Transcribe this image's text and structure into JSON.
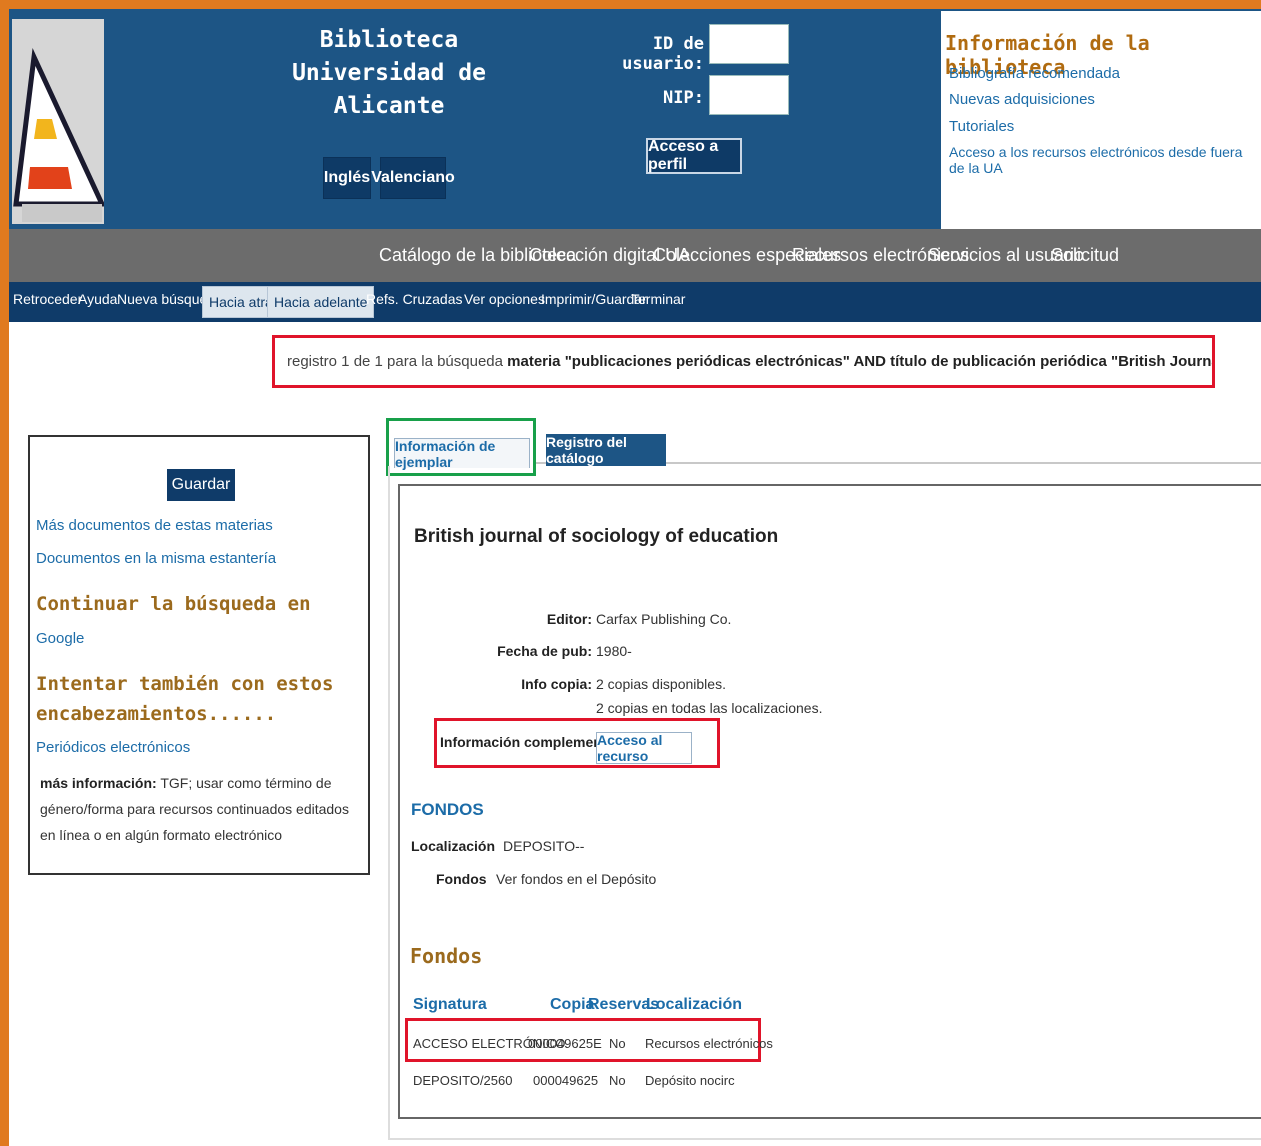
{
  "header": {
    "title_line1": "Biblioteca",
    "title_line2": "Universidad de Alicante",
    "lang_en": "Inglés",
    "lang_va": "Valenciano",
    "user_id_label": "ID de usuario:",
    "nip_label": "NIP:",
    "perfil_button": "Acceso a perfil",
    "info_title": "Información de la biblioteca",
    "info_links": [
      "Bibliografía recomendada",
      "Nuevas adquisiciones",
      "Tutoriales",
      "Acceso a los recursos electrónicos desde fuera de la UA"
    ]
  },
  "main_nav": [
    "Catálogo de la biblioteca",
    "Colección digital UA",
    "Colecciones especiales",
    "Recursos electrónicos",
    "Servicios al usuario",
    "Solicitud"
  ],
  "sub_nav": [
    "Retroceder",
    "Ayuda",
    "Nueva búsqueda",
    "Hacia atrás",
    "Hacia adelante",
    "Refs. Cruzadas",
    "Ver opciones",
    "Imprimir/Guardar",
    "Terminar"
  ],
  "summary": {
    "prefix": "registro 1 de 1 para la búsqueda ",
    "query": "materia \"publicaciones periódicas electrónicas\" AND título de publicación periódica \"British Journal of Sociology of Education\""
  },
  "left_panel": {
    "save_button": "Guardar",
    "link1": "Más documentos de estas materias",
    "link2": "Documentos en la misma estantería",
    "continue_heading": "Continuar la búsqueda en",
    "google": "Google",
    "try_heading1": "Intentar también con estos",
    "try_heading2": "encabezamientos......",
    "heading_link": "Periódicos electrónicos",
    "more_info_label": "más información:",
    "more_info_text": " TGF; usar como término de género/forma para recursos continuados editados en línea o en algún formato electrónico"
  },
  "tabs": {
    "tab1": "Información de ejemplar",
    "tab2": "Registro del catálogo"
  },
  "record": {
    "title": "British journal of sociology of education",
    "editor_label": "Editor:",
    "editor_value": "Carfax Publishing Co.",
    "fecha_label": "Fecha de pub:",
    "fecha_value": "1980-",
    "info_copia_label": "Info copia:",
    "info_copia_value1": "2 copias disponibles.",
    "info_copia_value2": "2 copias en todas las localizaciones.",
    "info_comp_label": "Información complementaria",
    "acceso_recurso": "Acceso al recurso",
    "fondos_heading": "FONDOS",
    "localizacion_label": "Localización",
    "localizacion_value": "DEPOSITO--",
    "fondos_label": "Fondos",
    "fondos_value": "Ver fondos en el Depósito",
    "holdings_heading": "Fondos",
    "columns": [
      "Signatura",
      "Copia",
      "Reservas",
      "Localización"
    ],
    "rows": [
      [
        "ACCESO ELECTRÓNICO",
        "000049625E",
        "No",
        "Recursos electrónicos"
      ],
      [
        "DEPOSITO/2560",
        "000049625",
        "No",
        "Depósito nocirc"
      ]
    ]
  },
  "colors": {
    "header_blue": "#1d5585",
    "nav_grey": "#6c6c6c",
    "nav_blue": "#0f3b69",
    "link_blue": "#1c6ca8",
    "heading_brown": "#9b6a1d",
    "highlight_red": "#e0142a",
    "highlight_green": "#18a04a",
    "frame_orange": "#e07a1f"
  }
}
